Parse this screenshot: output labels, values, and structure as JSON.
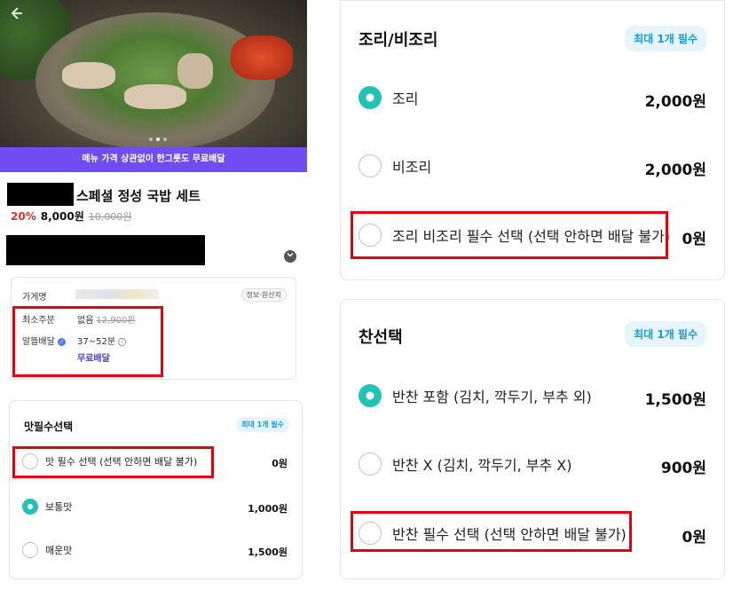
{
  "left": {
    "promo_banner": "메뉴 가격 상관없이 한그릇도 무료배달",
    "menu": {
      "title": "스페셜 정성 국밥 세트",
      "discount": "20%",
      "price": "8,000원",
      "original_price": "10,000원"
    },
    "store_info": {
      "store_label": "가게명",
      "info_button": "정보·원산지",
      "min_order_label": "최소주문",
      "min_order_value": "없음",
      "min_order_strike": "12,900원",
      "delivery_label": "알뜰배달",
      "delivery_time": "37~52분",
      "delivery_fee": "무료배달"
    },
    "taste_card": {
      "title": "맛필수선택",
      "badge": "최대 1개 필수",
      "options": [
        {
          "label": "맛 필수 선택 (선택 안하면 배달 불가)",
          "price": "0원",
          "selected": false
        },
        {
          "label": "보통맛",
          "price": "1,000원",
          "selected": true
        },
        {
          "label": "매운맛",
          "price": "1,500원",
          "selected": false
        }
      ]
    }
  },
  "right": {
    "cook_card": {
      "title": "조리/비조리",
      "badge": "최대 1개 필수",
      "options": [
        {
          "label": "조리",
          "price": "2,000원",
          "selected": true
        },
        {
          "label": "비조리",
          "price": "2,000원",
          "selected": false
        },
        {
          "label": "조리 비조리 필수 선택 (선택 안하면 배달 불가)",
          "price": "0원",
          "selected": false
        }
      ]
    },
    "side_card": {
      "title": "찬선택",
      "badge": "최대 1개 필수",
      "options": [
        {
          "label": "반찬 포함 (김치, 깍두기, 부추 외)",
          "price": "1,500원",
          "selected": true
        },
        {
          "label": "반찬 X (김치, 깍두기, 부추 X)",
          "price": "900원",
          "selected": false
        },
        {
          "label": "반찬 필수 선택 (선택 안하면 배달 불가)",
          "price": "0원",
          "selected": false
        }
      ]
    }
  },
  "colors": {
    "brand_purple": "#6f4df0",
    "radio_selected": "#22c3b2",
    "highlight_red": "#e8000f",
    "badge_text": "#1a9ad6",
    "discount_red": "#e0302a"
  },
  "icons": {
    "back": "arrow-left-icon",
    "expand": "chevron-down-icon",
    "delivery_badge": "delivery-badge-icon",
    "info": "info-icon"
  }
}
